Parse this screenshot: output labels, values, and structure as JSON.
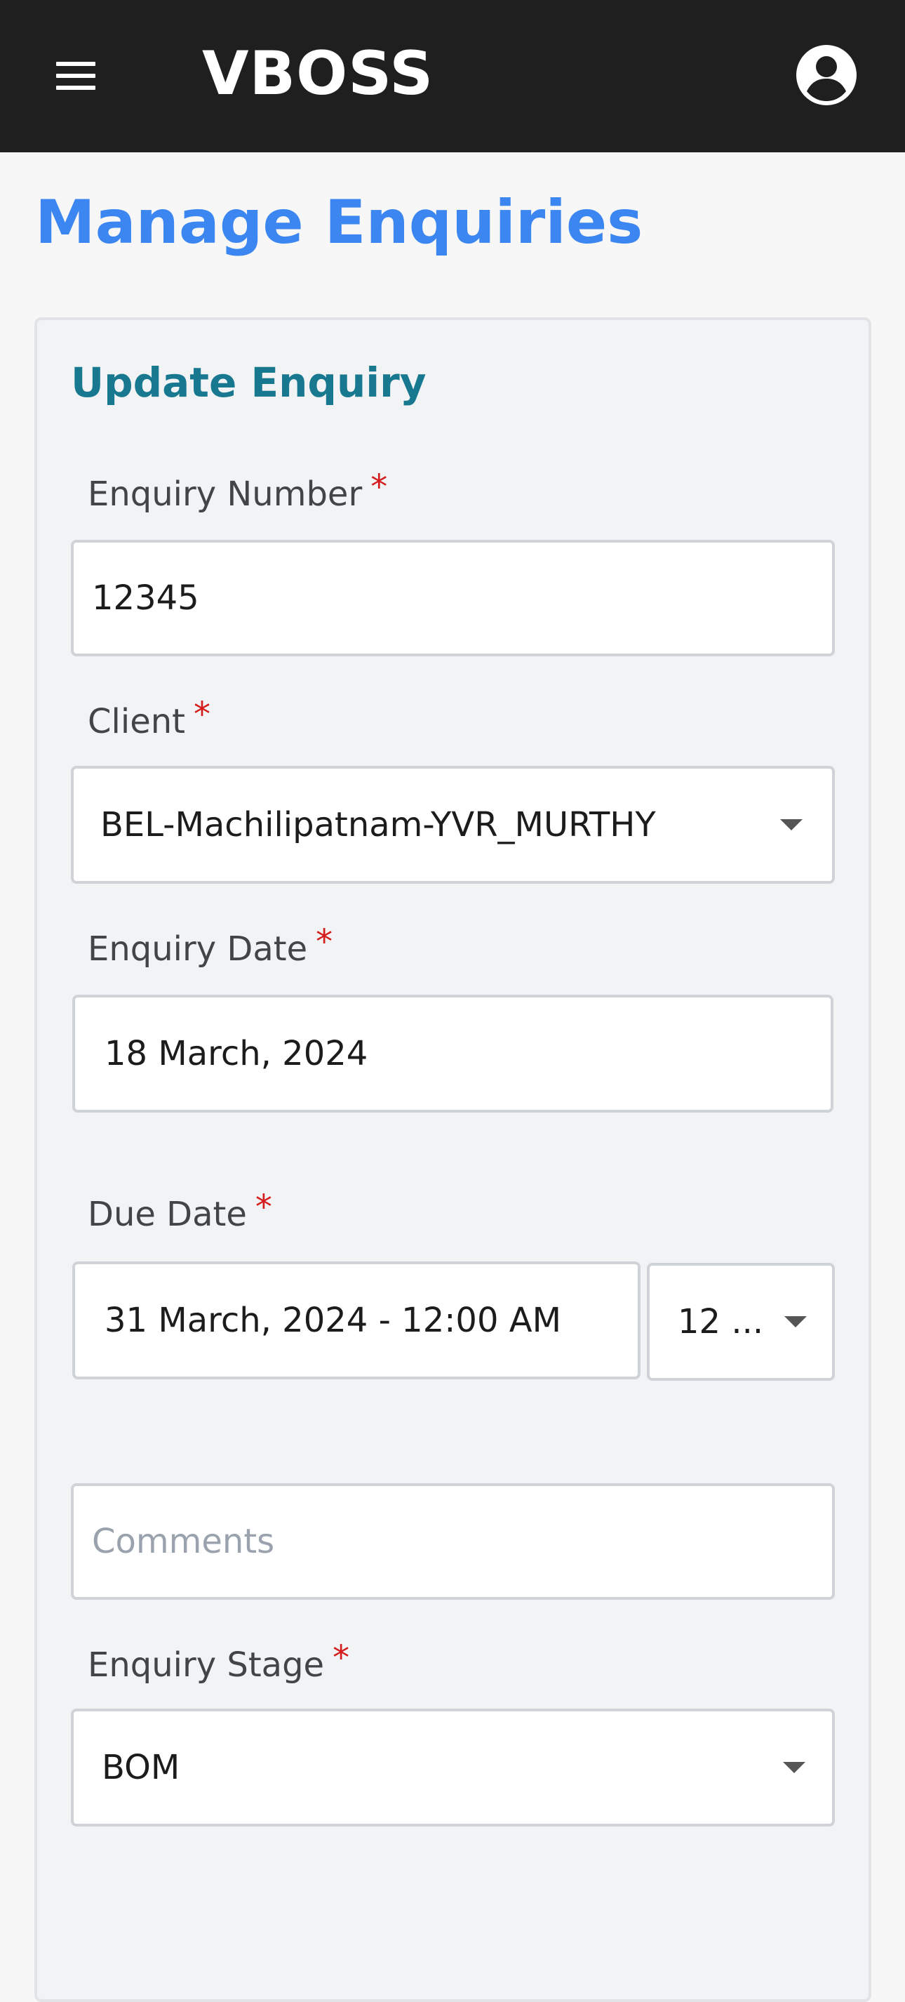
{
  "app": {
    "brand": "VBOSS"
  },
  "header": {
    "menu_icon": "hamburger-icon",
    "account_icon": "account-circle-icon"
  },
  "page": {
    "title": "Manage Enquiries"
  },
  "form": {
    "title": "Update Enquiry",
    "required_mark": "*",
    "enquiry_number": {
      "label": "Enquiry Number",
      "value": "12345"
    },
    "client": {
      "label": "Client",
      "value": "BEL-Machilipatnam-YVR_MURTHY"
    },
    "enquiry_date": {
      "label": "Enquiry Date",
      "value": "18 March, 2024"
    },
    "due_date": {
      "label": "Due Date",
      "value": "31 March, 2024 - 12:00 AM",
      "time_value": "12 ..."
    },
    "comments": {
      "placeholder": "Comments",
      "value": ""
    },
    "enquiry_stage": {
      "label": "Enquiry Stage",
      "value": "BOM"
    }
  },
  "colors": {
    "header_bg": "#1f1f1f",
    "page_title": "#3b86f0",
    "card_title": "#17788f",
    "required": "#d41c1c"
  }
}
